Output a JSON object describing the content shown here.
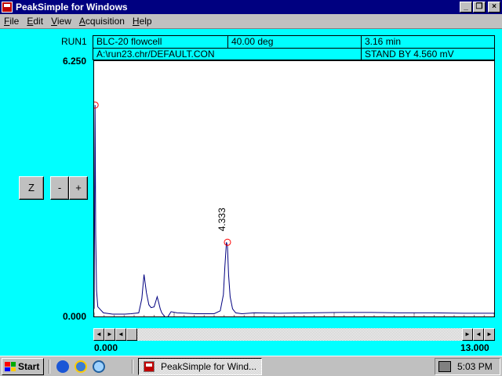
{
  "window": {
    "title": "PeakSimple for Windows",
    "minimize": "_",
    "restore": "❐",
    "close": "×"
  },
  "menu": [
    {
      "u": "F",
      "rest": "ile"
    },
    {
      "u": "E",
      "rest": "dit"
    },
    {
      "u": "V",
      "rest": "iew"
    },
    {
      "u": "A",
      "rest": "cquisition"
    },
    {
      "u": "H",
      "rest": "elp"
    }
  ],
  "run": {
    "label": "RUN1",
    "detector": "BLC-20 flowcell",
    "temperature": "40.00 deg",
    "time": "3.16 min",
    "file": "A:\\run23.chr/DEFAULT.CON",
    "status": "STAND BY 4.560 mV"
  },
  "axis": {
    "y_max": "6.250",
    "y_min": "0.000",
    "x_min": "0.000",
    "x_max": "13.000"
  },
  "controls": {
    "zoom": "Z",
    "minus": "-",
    "plus": "+"
  },
  "chart_data": {
    "type": "line",
    "xlim": [
      0,
      13
    ],
    "ylim": [
      0,
      6.25
    ],
    "series": [
      {
        "x": [
          0.0,
          0.03,
          0.05,
          0.08,
          0.12,
          0.3,
          0.6,
          1.0,
          1.2,
          1.45,
          1.55,
          1.62,
          1.7,
          1.78,
          1.85,
          1.95,
          2.05,
          2.1,
          2.15,
          2.2,
          2.25,
          2.35,
          2.5,
          2.7,
          3.0,
          3.3,
          3.6,
          3.9,
          4.1,
          4.2,
          4.25,
          4.3,
          4.333,
          4.37,
          4.42,
          4.5,
          4.6,
          4.8,
          5.2,
          6.0,
          7.0,
          8.0,
          9.0,
          10.0,
          11.0,
          12.0,
          13.0
        ],
        "y": [
          0.15,
          5.2,
          2.0,
          0.6,
          0.2,
          0.05,
          0.02,
          0.02,
          0.03,
          0.05,
          0.4,
          1.0,
          0.55,
          0.25,
          0.18,
          0.2,
          0.45,
          0.3,
          0.15,
          0.05,
          0.0,
          -0.1,
          0.08,
          0.05,
          0.04,
          0.03,
          0.03,
          0.03,
          0.1,
          0.5,
          1.2,
          1.8,
          1.7,
          1.0,
          0.45,
          0.15,
          0.05,
          0.03,
          0.05,
          0.04,
          0.05,
          0.06,
          0.06,
          0.05,
          0.05,
          0.04,
          0.04
        ]
      }
    ],
    "peaks": [
      {
        "x": 0.03,
        "y": 5.2
      },
      {
        "x": 4.333,
        "y": 1.8,
        "label": "4.333"
      }
    ]
  },
  "scroll": {
    "left_arrow": "◄",
    "right_arrow": "►"
  },
  "taskbar": {
    "start": "Start",
    "task": "PeakSimple for Wind...",
    "clock": "5:03 PM"
  }
}
